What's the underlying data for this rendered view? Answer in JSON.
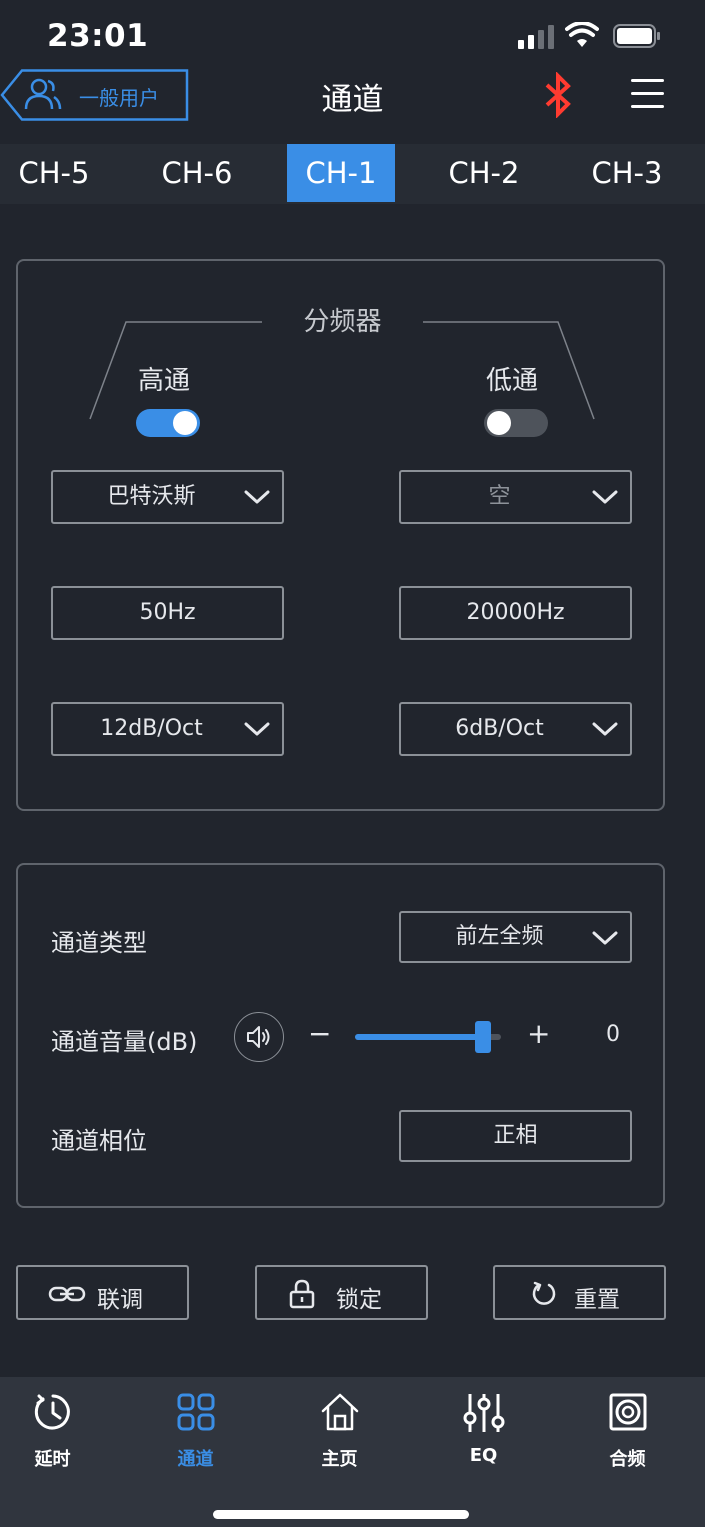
{
  "status": {
    "time": "23:01"
  },
  "header": {
    "user_label": "一般用户",
    "title": "通道"
  },
  "tabs": [
    {
      "label": "CH-5"
    },
    {
      "label": "CH-6"
    },
    {
      "label": "CH-1",
      "active": true
    },
    {
      "label": "CH-2"
    },
    {
      "label": "CH-3"
    }
  ],
  "crossover": {
    "title": "分频器",
    "highpass": {
      "label": "高通",
      "enabled": true,
      "filter_type": "巴特沃斯",
      "frequency": "50Hz",
      "slope": "12dB/Oct"
    },
    "lowpass": {
      "label": "低通",
      "enabled": false,
      "filter_type": "空",
      "frequency": "20000Hz",
      "slope": "6dB/Oct"
    }
  },
  "settings": {
    "type_label": "通道类型",
    "type_value": "前左全频",
    "volume_label": "通道音量(dB)",
    "volume_minus": "−",
    "volume_plus": "+",
    "volume_value": "0",
    "volume_level": 0.88,
    "phase_label": "通道相位",
    "phase_value": "正相"
  },
  "actions": {
    "link": "联调",
    "lock": "锁定",
    "reset": "重置"
  },
  "nav": [
    {
      "label": "延时",
      "icon": "clock-icon"
    },
    {
      "label": "通道",
      "icon": "grid-icon",
      "active": true
    },
    {
      "label": "主页",
      "icon": "home-icon"
    },
    {
      "label": "EQ",
      "icon": "eq-sliders-icon"
    },
    {
      "label": "合频",
      "icon": "speaker-icon"
    }
  ],
  "colors": {
    "accent": "#3a8ee6",
    "bluetooth": "#ff3b30",
    "background": "#21252d"
  }
}
